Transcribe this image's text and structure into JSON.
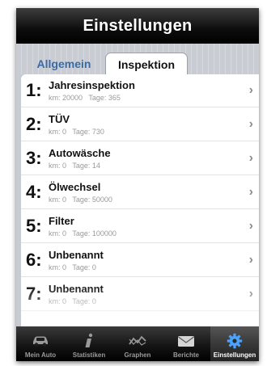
{
  "nav": {
    "title": "Einstellungen"
  },
  "segments": [
    {
      "label": "Allgemein",
      "selected": false
    },
    {
      "label": "Inspektion",
      "selected": true
    }
  ],
  "items": [
    {
      "num": "1:",
      "title": "Jahresinspektion",
      "sub": "km: 20000   Tage: 365"
    },
    {
      "num": "2:",
      "title": "TÜV",
      "sub": "km: 0   Tage: 730"
    },
    {
      "num": "3:",
      "title": "Autowäsche",
      "sub": "km: 0   Tage: 14"
    },
    {
      "num": "4:",
      "title": "Ölwechsel",
      "sub": "km: 0   Tage: 50000"
    },
    {
      "num": "5:",
      "title": "Filter",
      "sub": "km: 0   Tage: 100000"
    },
    {
      "num": "6:",
      "title": "Unbenannt",
      "sub": "km: 0   Tage: 0"
    },
    {
      "num": "7:",
      "title": "Unbenannt",
      "sub": "km: 0   Tage: 0"
    }
  ],
  "chevron": "›",
  "tabbar": [
    {
      "label": "Mein Auto",
      "icon": "car-icon",
      "active": false
    },
    {
      "label": "Statistiken",
      "icon": "info-icon",
      "active": false
    },
    {
      "label": "Graphen",
      "icon": "graph-icon",
      "active": false
    },
    {
      "label": "Berichte",
      "icon": "mail-icon",
      "active": false
    },
    {
      "label": "Einstellungen",
      "icon": "gear-icon",
      "active": true
    }
  ],
  "colors": {
    "active_tab_icon": "#4aa3ff",
    "inactive_tab_icon": "#9a9a9a",
    "segment_inactive_text": "#3a6aa8"
  }
}
